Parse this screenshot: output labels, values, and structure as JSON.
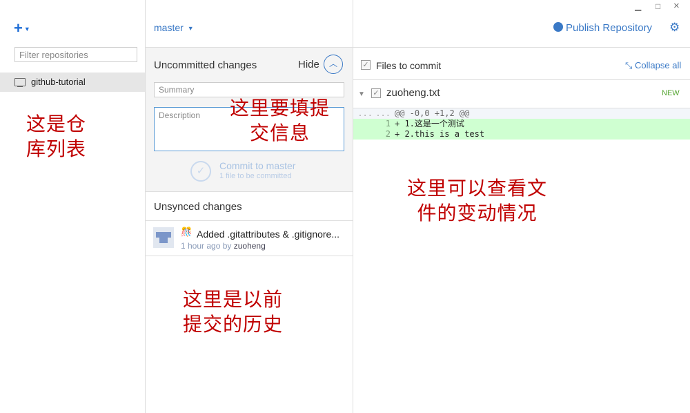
{
  "window": {
    "minimize": "▁",
    "maximize": "□",
    "close": "×"
  },
  "sidebar": {
    "add_label": "+",
    "filter_placeholder": "Filter repositories",
    "repos": [
      {
        "label": "github-tutorial",
        "icon": "computer-icon"
      }
    ]
  },
  "branch": {
    "label": "master"
  },
  "uncommitted": {
    "title": "Uncommitted changes",
    "hide_label": "Hide",
    "summary_placeholder": "Summary",
    "description_placeholder": "Description",
    "commit_label": "Commit to master",
    "commit_sub": "1 file to be committed"
  },
  "unsynced": {
    "title": "Unsynced changes",
    "item": {
      "emoji": "🎊",
      "message": "Added .gitattributes & .gitignore...",
      "time": "1 hour ago by",
      "author": "zuoheng"
    }
  },
  "header_right": {
    "publish_label": "Publish Repository",
    "settings_icon": "gear-icon"
  },
  "files": {
    "label": "Files to commit",
    "collapse_label": "Collapse all",
    "file": {
      "name": "zuoheng.txt",
      "badge": "NEW"
    }
  },
  "diff": {
    "hunk": {
      "n1": "...",
      "n2": "...",
      "text": "@@ -0,0 +1,2 @@"
    },
    "lines": [
      {
        "n1": "",
        "n2": "1",
        "text": "+ 1.这是一个测试"
      },
      {
        "n1": "",
        "n2": "2",
        "text": "+ 2.this is a test"
      }
    ]
  },
  "annotations": {
    "repo_list": [
      "这是仓",
      "库列表"
    ],
    "commit_info": [
      "这里要填提",
      "交信息"
    ],
    "history": [
      "这里是以前",
      "提交的历史"
    ],
    "changes": [
      "这里可以查看文",
      "件的变动情况"
    ]
  },
  "colors": {
    "accent": "#3a79c6",
    "annotation": "#c00000",
    "added_bg": "#cfffd1",
    "new_badge": "#55a532"
  }
}
